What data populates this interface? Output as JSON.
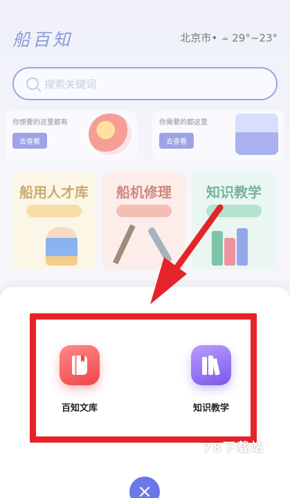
{
  "header": {
    "logo_text": "船百知",
    "city": "北京市•",
    "weather_icon": "cloud-icon",
    "temperature": "29°~23°"
  },
  "search": {
    "placeholder": "搜索关键词"
  },
  "banners": [
    {
      "text": "你想要的这里都有",
      "button": "去查看"
    },
    {
      "text": "你需要的都这里",
      "button": "去查看"
    }
  ],
  "feature_cards": [
    {
      "title": "船用人才库"
    },
    {
      "title": "船机修理"
    },
    {
      "title": "知识教学"
    }
  ],
  "sheet": {
    "entries": [
      {
        "label": "百知文库",
        "icon": "book-icon"
      },
      {
        "label": "知识教学",
        "icon": "books-icon"
      }
    ],
    "close_icon": "close-icon"
  },
  "annotation": {
    "highlight_color": "#e5232a"
  },
  "watermark": {
    "text": "78下载站"
  },
  "colors": {
    "accent": "#6a72d8",
    "library_tile": "#f0454c",
    "teaching_tile": "#7b58ea"
  }
}
